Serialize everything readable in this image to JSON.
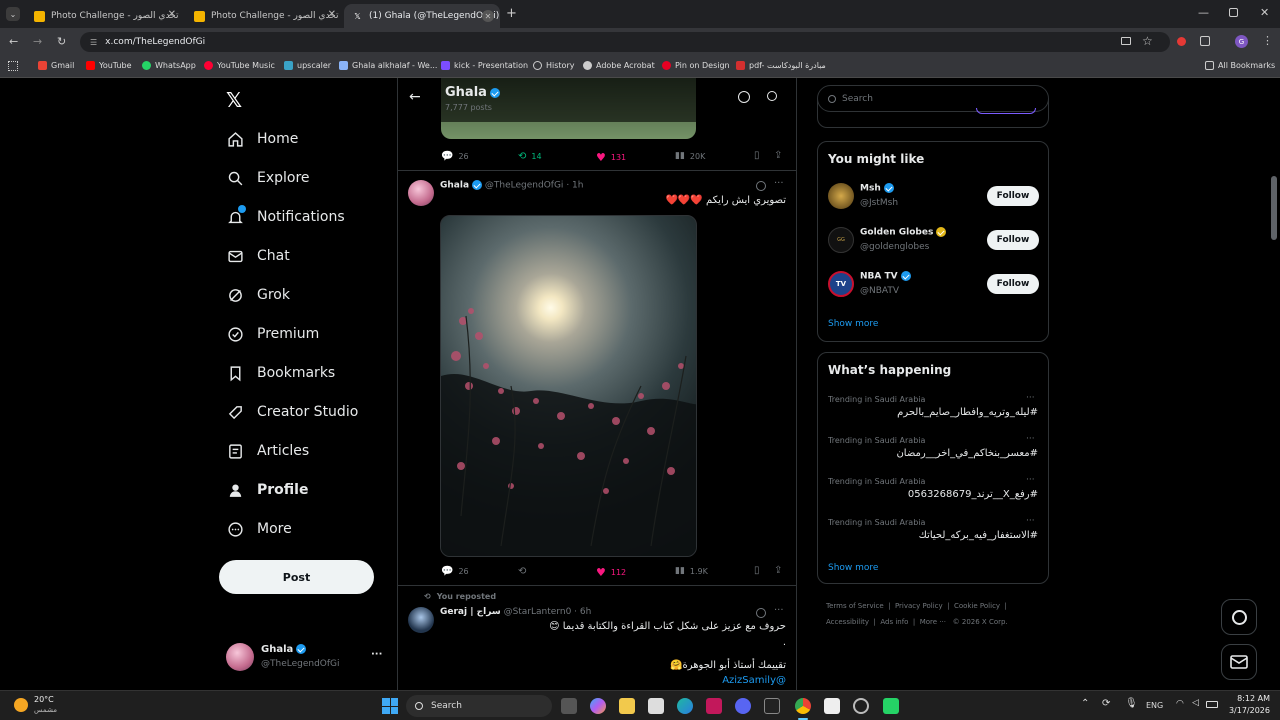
{
  "browser": {
    "tabs": [
      {
        "title": "Photo Challenge - تحدي الصور",
        "active": false
      },
      {
        "title": "Photo Challenge - تحدي الصور",
        "active": false
      },
      {
        "title": "(1) Ghala (@TheLegendOfGi) /",
        "active": true
      }
    ],
    "url": "x.com/TheLegendOfGi",
    "bookmarks": [
      "Gmail",
      "YouTube",
      "WhatsApp",
      "YouTube Music",
      "upscaler",
      "Ghala alkhalaf - We...",
      "kick - Presentation",
      "History",
      "Adobe Acrobat",
      "Pin on Design",
      "pdf- مبادرة البودكاست",
      "All Bookmarks"
    ]
  },
  "sidebar": {
    "nav": [
      "Home",
      "Explore",
      "Notifications",
      "Chat",
      "Grok",
      "Premium",
      "Bookmarks",
      "Creator Studio",
      "Articles",
      "Profile",
      "More"
    ],
    "post_button": "Post",
    "account": {
      "name": "Ghala",
      "handle": "@TheLegendOfGi"
    }
  },
  "header": {
    "name": "Ghala",
    "posts": "7,777 posts"
  },
  "prev_post_actions": {
    "replies": "26",
    "reposts": "14",
    "likes": "131",
    "views": "20K"
  },
  "post": {
    "name": "Ghala",
    "handle": "@TheLegendOfGi",
    "time": "· 1h",
    "text": "تصويري ايش رايكم ❤️❤️❤️",
    "actions": {
      "replies": "26",
      "likes": "112",
      "views": "1.9K"
    }
  },
  "repost": {
    "label": "You reposted",
    "name": "Geraj | سراج",
    "handle": "@StarLantern0",
    "time": "· 6h",
    "text1": "حروف مع عزيز على شكل كتاب القراءة والكتابة قديما 😊",
    "text2": ".",
    "text3": "تقييمك أستاذ أبو الجوهرة🤗",
    "mention": "@AzizSamily"
  },
  "right": {
    "search_placeholder": "Search",
    "might_like_title": "You might like",
    "suggestions": [
      {
        "name": "Msh",
        "handle": "@JstMsh",
        "badge": "blue"
      },
      {
        "name": "Golden Globes",
        "handle": "@goldenglobes",
        "badge": "gold"
      },
      {
        "name": "NBA TV",
        "handle": "@NBATV",
        "badge": "blue"
      }
    ],
    "follow_label": "Follow",
    "show_more": "Show more",
    "happening_title": "What’s happening",
    "trends": [
      {
        "context": "Trending in Saudi Arabia",
        "topic": "#ليله_وتريه_وافطار_صايم_بالحرم"
      },
      {
        "context": "Trending in Saudi Arabia",
        "topic": "#معسر_بنخاكم_في_اخر__رمضان"
      },
      {
        "context": "Trending in Saudi Arabia",
        "topic": "#رفع_X__ترند_0563268679"
      },
      {
        "context": "Trending in Saudi Arabia",
        "topic": "#الاستغفار_فيه_بركه_لحياتك"
      }
    ],
    "footer": [
      "Terms of Service",
      "Privacy Policy",
      "Cookie Policy",
      "Accessibility",
      "Ads info",
      "More ···",
      "© 2026 X Corp."
    ]
  },
  "taskbar": {
    "weather_temp": "20°C",
    "weather_text": "مشمس",
    "search": "Search",
    "lang": "ENG",
    "time": "8:12 AM",
    "date": "3/17/2026"
  },
  "colors": {
    "accent": "#1d9bf0",
    "like": "#f91880",
    "repost": "#00ba7c"
  }
}
